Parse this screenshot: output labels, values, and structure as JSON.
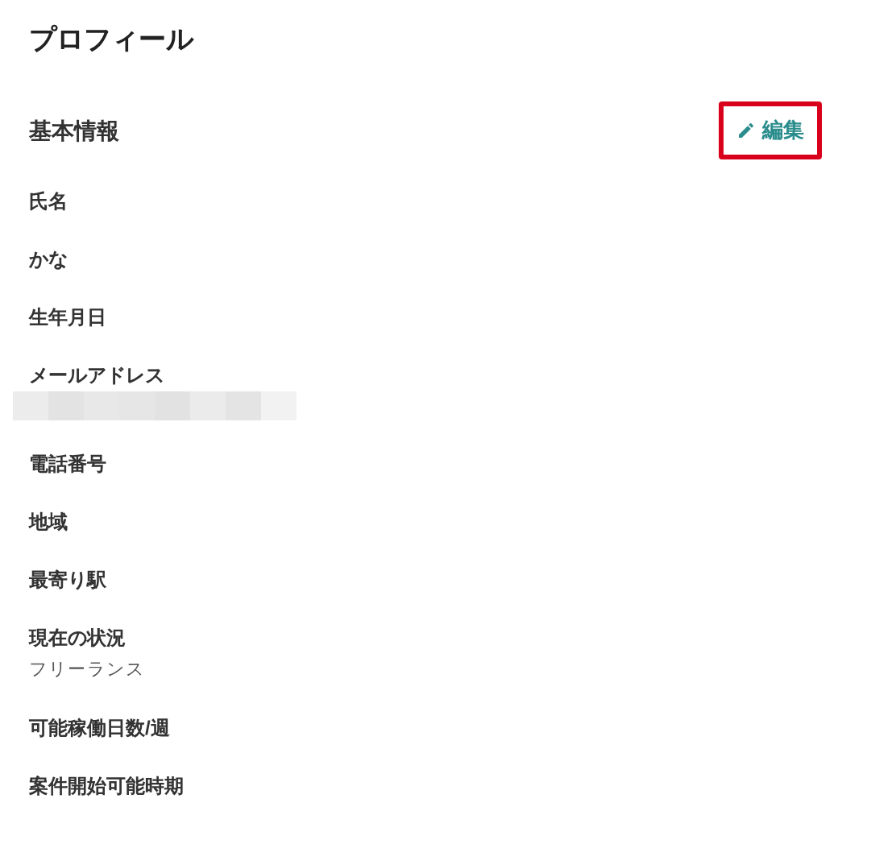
{
  "page_title": "プロフィール",
  "section": {
    "title": "基本情報",
    "edit_button": {
      "label": "編集",
      "highlighted": true
    }
  },
  "fields": [
    {
      "label": "氏名"
    },
    {
      "label": "かな"
    },
    {
      "label": "生年月日"
    },
    {
      "label": "メールアドレス",
      "redacted": true
    },
    {
      "label": "電話番号"
    },
    {
      "label": "地域"
    },
    {
      "label": "最寄り駅"
    },
    {
      "label": "現在の状況",
      "value": "フリーランス"
    },
    {
      "label": "可能稼働日数/週"
    },
    {
      "label": "案件開始可能時期"
    }
  ]
}
